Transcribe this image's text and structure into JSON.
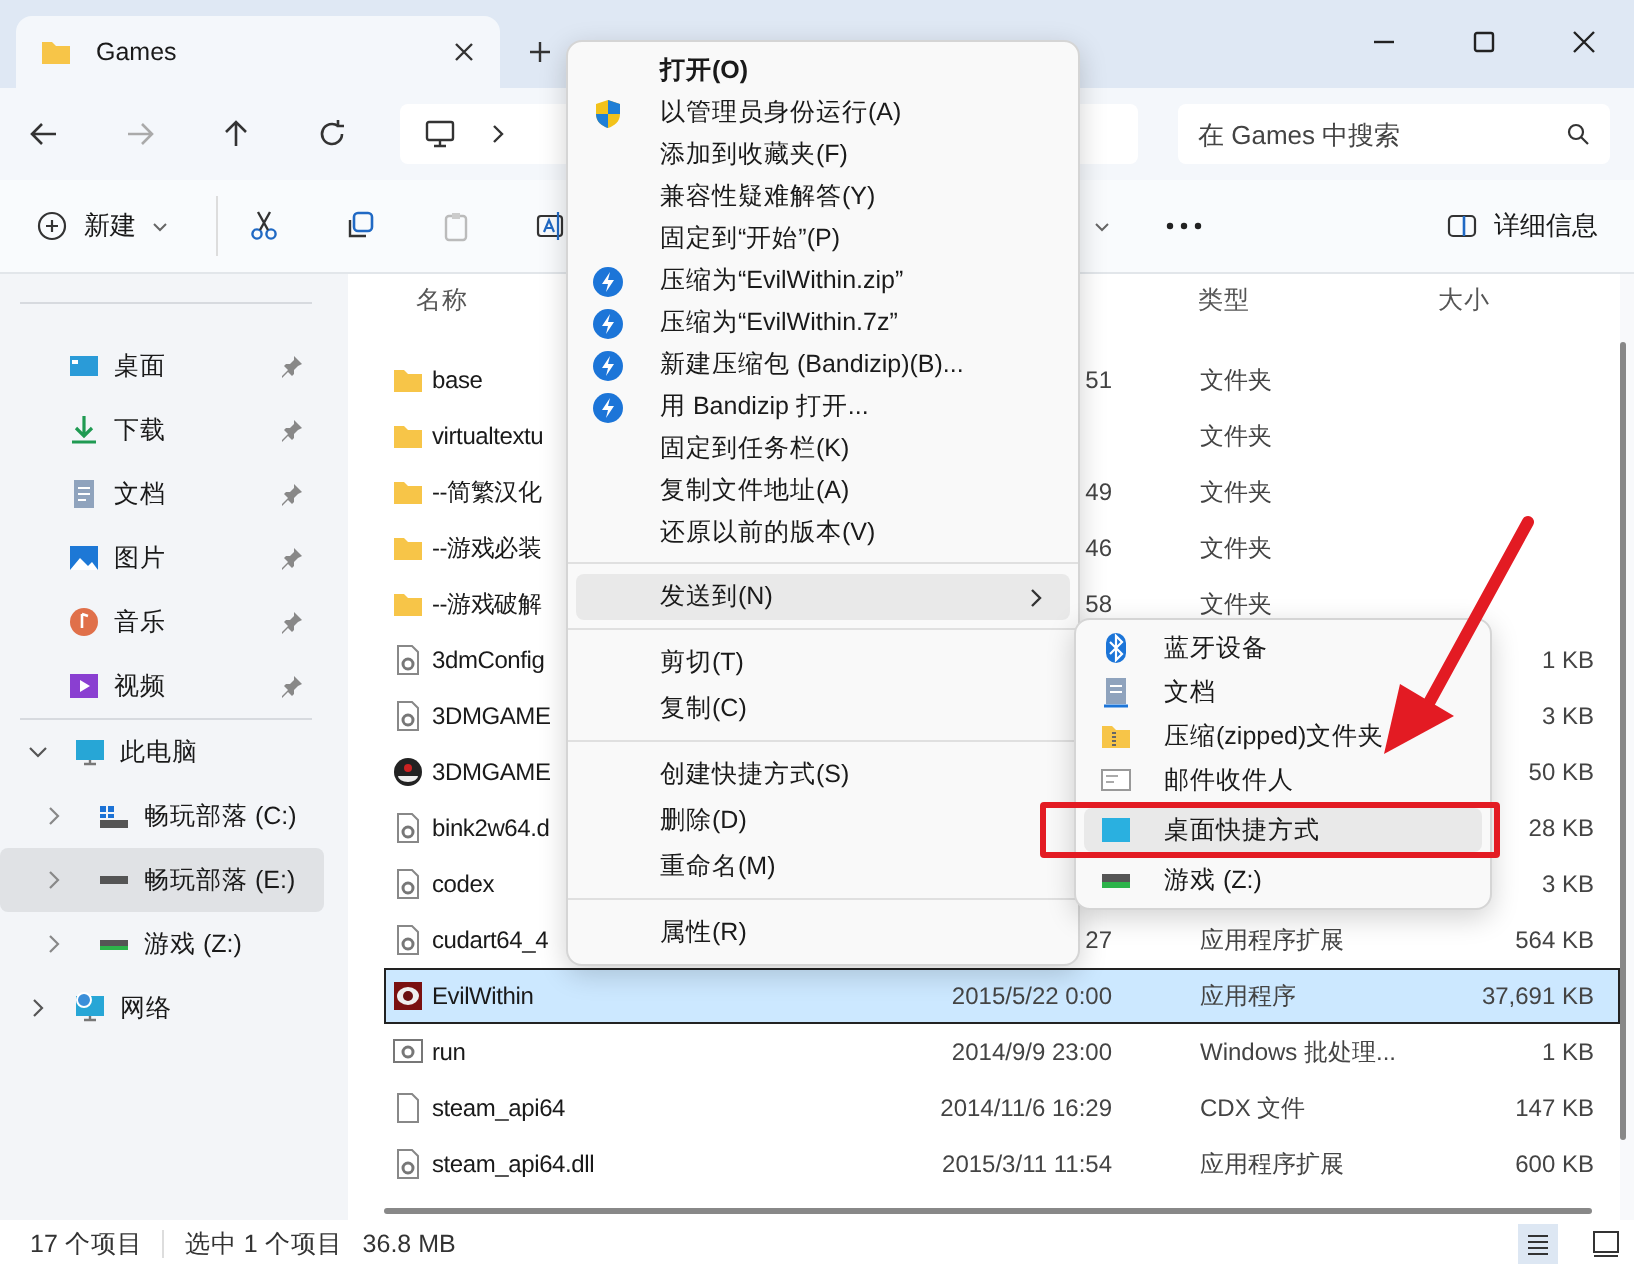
{
  "tab": {
    "title": "Games"
  },
  "search": {
    "placeholder": "在 Games 中搜索"
  },
  "toolbar": {
    "new_label": "新建",
    "details_label": "详细信息"
  },
  "sidebar": {
    "quick_access": [
      {
        "label": "桌面"
      },
      {
        "label": "下载"
      },
      {
        "label": "文档"
      },
      {
        "label": "图片"
      },
      {
        "label": "音乐"
      },
      {
        "label": "视频"
      }
    ],
    "tree": [
      {
        "label": "此电脑",
        "kind": "computer",
        "expanded": true,
        "selected": false,
        "children": [
          {
            "label": "畅玩部落 (C:)",
            "kind": "system_drive",
            "expanded": false,
            "selected": false
          },
          {
            "label": "畅玩部落 (E:)",
            "kind": "drive",
            "expanded": false,
            "selected": true
          },
          {
            "label": "游戏 (Z:)",
            "kind": "network_drive",
            "expanded": false,
            "selected": false
          }
        ]
      },
      {
        "label": "网络",
        "kind": "network",
        "expanded": false,
        "selected": false
      }
    ]
  },
  "table": {
    "columns": [
      "名称",
      "类型",
      "大小"
    ],
    "rows": [
      {
        "name": "base",
        "kind": "folder",
        "date": "51",
        "type": "文件夹",
        "selected": false
      },
      {
        "name": "virtualtextu",
        "kind": "folder",
        "type": "文件夹",
        "selected": false
      },
      {
        "name": "--简繁汉化",
        "kind": "folder",
        "date": "49",
        "type": "文件夹",
        "selected": false
      },
      {
        "name": "--游戏必装",
        "kind": "folder",
        "date": "46",
        "type": "文件夹",
        "selected": false
      },
      {
        "name": "--游戏破解",
        "kind": "folder",
        "date": "58",
        "type": "文件夹",
        "selected": false
      },
      {
        "name": "3dmConfig",
        "kind": "settings_file",
        "size": "1 KB",
        "selected": false
      },
      {
        "name": "3DMGAME",
        "kind": "settings_file",
        "size": "3 KB",
        "selected": false
      },
      {
        "name": "3DMGAME",
        "kind": "app",
        "size": "50 KB",
        "selected": false
      },
      {
        "name": "bink2w64.d",
        "kind": "library",
        "size": "28 KB",
        "selected": false
      },
      {
        "name": "codex",
        "kind": "settings_file",
        "size": "3 KB",
        "selected": false
      },
      {
        "name": "cudart64_4",
        "kind": "library",
        "date": "27",
        "type": "应用程序扩展",
        "size": "564 KB",
        "selected": false
      },
      {
        "name": "EvilWithin",
        "kind": "game",
        "date": "2015/5/22 0:00",
        "type": "应用程序",
        "size": "37,691 KB",
        "selected": true
      },
      {
        "name": "run",
        "kind": "batch",
        "date": "2014/9/9 23:00",
        "type": "Windows 批处理...",
        "size": "1 KB",
        "selected": false
      },
      {
        "name": "steam_api64",
        "kind": "blank",
        "date": "2014/11/6 16:29",
        "type": "CDX 文件",
        "size": "147 KB",
        "selected": false
      },
      {
        "name": "steam_api64.dll",
        "kind": "library",
        "date": "2015/3/11 11:54",
        "type": "应用程序扩展",
        "size": "600 KB",
        "selected": false
      }
    ]
  },
  "status_bar": {
    "count": "17 个项目",
    "selection": "选中 1 个项目",
    "selection_size": "36.8 MB"
  },
  "context_menu": [
    {
      "kind": "default",
      "label": "打开(O)",
      "selected": false
    },
    {
      "kind": "admin",
      "label": "以管理员身份运行(A)",
      "selected": false
    },
    {
      "kind": "plain",
      "label": "添加到收藏夹(F)",
      "selected": false
    },
    {
      "kind": "plain",
      "label": "兼容性疑难解答(Y)",
      "selected": false
    },
    {
      "kind": "plain",
      "label": "固定到“开始”(P)",
      "selected": false
    },
    {
      "kind": "archiver",
      "label": "压缩为“EvilWithin.zip”",
      "selected": false
    },
    {
      "kind": "archiver",
      "label": "压缩为“EvilWithin.7z”",
      "selected": false
    },
    {
      "kind": "archiver",
      "label": "新建压缩包 (Bandizip)(B)...",
      "selected": false
    },
    {
      "kind": "archiver",
      "label": "用 Bandizip 打开...",
      "selected": false
    },
    {
      "kind": "plain",
      "label": "固定到任务栏(K)",
      "selected": false
    },
    {
      "kind": "plain",
      "label": "复制文件地址(A)",
      "selected": false
    },
    {
      "kind": "plain",
      "label": "还原以前的版本(V)",
      "selected": false
    },
    {
      "kind": "separator"
    },
    {
      "kind": "submenu",
      "label": "发送到(N)",
      "selected": true
    },
    {
      "kind": "separator"
    },
    {
      "kind": "plain",
      "label": "剪切(T)",
      "selected": false
    },
    {
      "kind": "plain",
      "label": "复制(C)",
      "selected": false
    },
    {
      "kind": "separator"
    },
    {
      "kind": "plain",
      "label": "创建快捷方式(S)",
      "selected": false
    },
    {
      "kind": "plain",
      "label": "删除(D)",
      "selected": false
    },
    {
      "kind": "plain",
      "label": "重命名(M)",
      "selected": false
    },
    {
      "kind": "separator"
    },
    {
      "kind": "plain",
      "label": "属性(R)",
      "selected": false
    }
  ],
  "send_to_menu": [
    {
      "label": "蓝牙设备",
      "kind": "bluetooth",
      "selected": false
    },
    {
      "label": "文档",
      "kind": "documents",
      "selected": false
    },
    {
      "label": "压缩(zipped)文件夹",
      "kind": "zip",
      "selected": false
    },
    {
      "label": "邮件收件人",
      "kind": "mail",
      "selected": false
    },
    {
      "label": "桌面快捷方式",
      "kind": "desktop",
      "selected": true
    },
    {
      "label": "游戏 (Z:)",
      "kind": "network_drive",
      "selected": false
    }
  ]
}
